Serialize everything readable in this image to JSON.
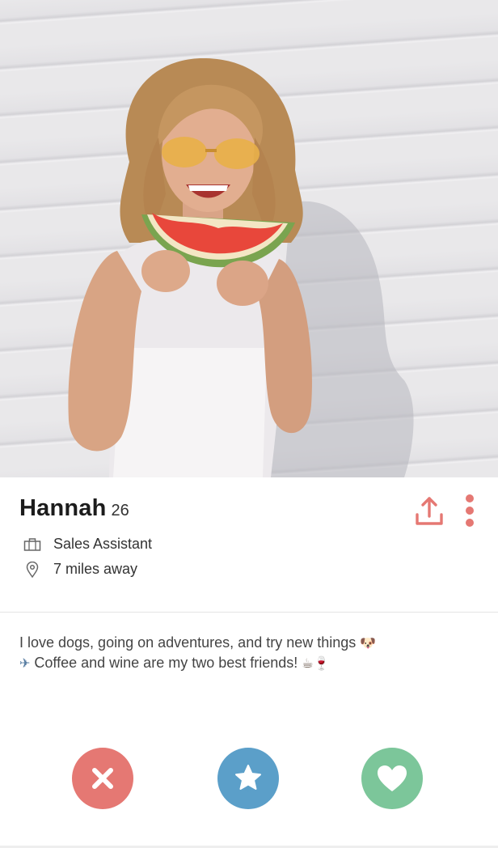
{
  "profile": {
    "name": "Hannah",
    "age": "26",
    "job": "Sales Assistant",
    "distance": "7 miles away",
    "bio": "I love dogs, going on adventures, and try new things",
    "bio_line2": "Coffee and wine are my two best friends!"
  },
  "icons": {
    "share": "share-icon",
    "more": "more-vertical-icon",
    "job": "briefcase-icon",
    "location": "location-pin-icon",
    "dog_emoji": "🐶",
    "plane_emoji": "✈",
    "coffee_emoji": "☕",
    "wine_emoji": "🍷",
    "nope": "close-icon",
    "super_like": "star-icon",
    "like": "heart-icon"
  },
  "colors": {
    "accent": "#e57873",
    "nope": "#e57873",
    "super_like": "#5b9fc9",
    "like": "#7cc69a"
  }
}
